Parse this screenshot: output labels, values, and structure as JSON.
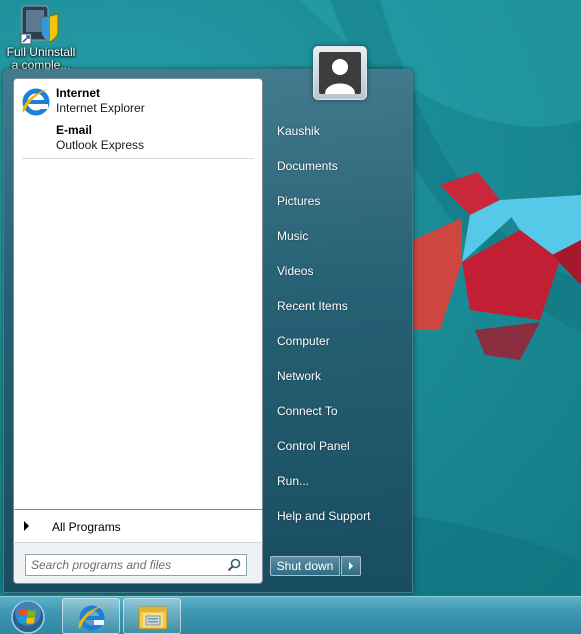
{
  "desktop": {
    "icon_label": "Full Uninstall",
    "icon_label_line2": "a comple..."
  },
  "start_menu": {
    "pinned": [
      {
        "title": "Internet",
        "subtitle": "Internet Explorer",
        "icon": "internet-explorer-icon"
      },
      {
        "title": "E-mail",
        "subtitle": "Outlook Express",
        "icon": "email-icon"
      }
    ],
    "all_programs_label": "All Programs",
    "search_placeholder": "Search programs and files",
    "right_items": [
      "Kaushik",
      "Documents",
      "Pictures",
      "Music",
      "Videos",
      "Recent Items",
      "Computer",
      "Network",
      "Connect To",
      "Control Panel",
      "Run...",
      "Help and Support"
    ],
    "shutdown_label": "Shut down"
  },
  "taskbar": {
    "buttons": [
      {
        "name": "start-orb",
        "icon": "windows-logo-icon"
      },
      {
        "name": "internet-explorer",
        "icon": "internet-explorer-icon"
      },
      {
        "name": "file-explorer",
        "icon": "folder-icon"
      }
    ]
  }
}
